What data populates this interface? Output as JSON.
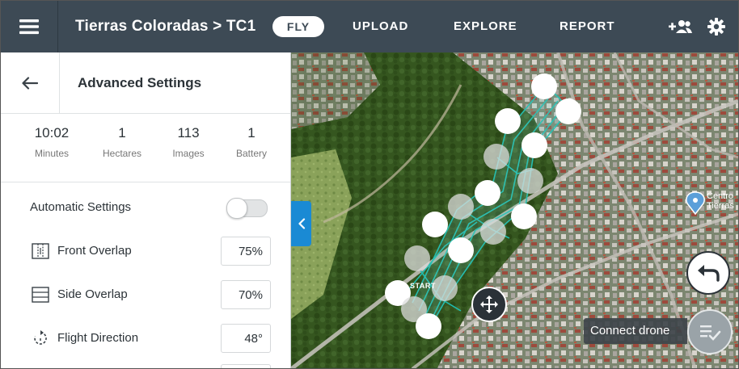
{
  "topbar": {
    "project_title": "Tierras Coloradas > TC1",
    "nav": {
      "fly": "FLY",
      "upload": "UPLOAD",
      "explore": "EXPLORE",
      "report": "REPORT"
    },
    "icons": {
      "menu": "hamburger-icon",
      "add_user": "add-user-icon",
      "settings": "gear-icon"
    },
    "bg_color": "#3d4a55"
  },
  "panel": {
    "title": "Advanced Settings",
    "stats": [
      {
        "value": "10:02",
        "label": "Minutes"
      },
      {
        "value": "1",
        "label": "Hectares"
      },
      {
        "value": "113",
        "label": "Images"
      },
      {
        "value": "1",
        "label": "Battery"
      }
    ],
    "automatic_settings": {
      "label": "Automatic Settings",
      "enabled": false
    },
    "front_overlap": {
      "label": "Front Overlap",
      "value": "75%"
    },
    "side_overlap": {
      "label": "Side Overlap",
      "value": "70%"
    },
    "flight_direction": {
      "label": "Flight Direction",
      "value": "48°"
    }
  },
  "map": {
    "start_label": "START",
    "poi_label": "Centro\nTierras",
    "connect_drone": "Connect drone",
    "flight_path_color": "#1fc1b5",
    "collapse_color": "#1a8ad4"
  }
}
